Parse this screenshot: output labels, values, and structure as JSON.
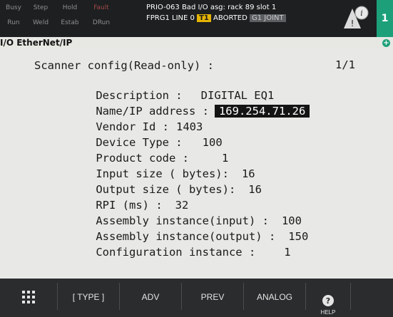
{
  "status": {
    "buttons": [
      "Busy",
      "Step",
      "Hold",
      "Fault",
      "Run",
      "Weld",
      "Estab",
      "DRun"
    ],
    "alarm_line1": "PRIO-063 Bad I/O asg: rack 89 slot 1",
    "alarm_line2_prefix": "FPRG1 LINE 0",
    "alarm_line2_tag": "T1",
    "alarm_line2_state": "ABORTED",
    "alarm_line2_joint": "G1 JOINT",
    "right_tab": "1"
  },
  "title": {
    "text": "I/O EtherNet/IP"
  },
  "screen": {
    "heading": "Scanner config(Read-only) :",
    "page": "1/1",
    "rows": [
      {
        "label": "Description :",
        "value": "DIGITAL EQ1"
      },
      {
        "label": "Name/IP address :",
        "value": "169.254.71.26"
      },
      {
        "label": "Vendor Id :",
        "value": "1403"
      },
      {
        "label": "Device Type :",
        "value": "100"
      },
      {
        "label": "Product code :",
        "value": "1"
      },
      {
        "label": "Input size ( bytes):",
        "value": "16"
      },
      {
        "label": "Output size ( bytes):",
        "value": "16"
      },
      {
        "label": "RPI (ms) :",
        "value": "32"
      },
      {
        "label": "Assembly instance(input) :",
        "value": "100"
      },
      {
        "label": "Assembly instance(output) :",
        "value": "150"
      },
      {
        "label": "Configuration instance :",
        "value": "1"
      }
    ]
  },
  "toolbar": {
    "type_label": "[ TYPE ]",
    "adv_label": "ADV",
    "prev_label": "PREV",
    "analog_label": "ANALOG",
    "help_label": "HELP"
  },
  "colors": {
    "accent_green": "#1da07a",
    "warning_yellow": "#e5b400",
    "screen_bg": "#e8e9e6"
  }
}
